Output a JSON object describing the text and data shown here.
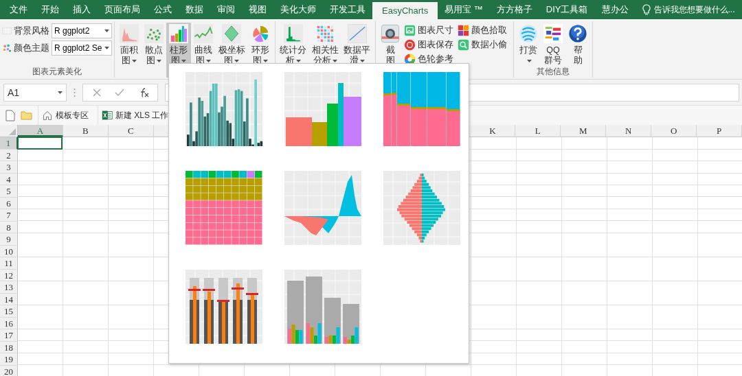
{
  "menu_tabs": [
    {
      "label": "文件",
      "selected": false
    },
    {
      "label": "开始",
      "selected": false
    },
    {
      "label": "插入",
      "selected": false
    },
    {
      "label": "页面布局",
      "selected": false
    },
    {
      "label": "公式",
      "selected": false
    },
    {
      "label": "数据",
      "selected": false
    },
    {
      "label": "审阅",
      "selected": false
    },
    {
      "label": "视图",
      "selected": false
    },
    {
      "label": "美化大师",
      "selected": false
    },
    {
      "label": "开发工具",
      "selected": false
    },
    {
      "label": "EasyCharts",
      "selected": true
    },
    {
      "label": "易用宝 ™",
      "selected": false
    },
    {
      "label": "方方格子",
      "selected": false
    },
    {
      "label": "DIY工具箱",
      "selected": false
    },
    {
      "label": "慧办公",
      "selected": false
    }
  ],
  "tell_me": {
    "placeholder": "告诉我您想要做什么..."
  },
  "ribbon": {
    "groups": [
      {
        "kind": "styles",
        "title": "图表元素美化",
        "rows": [
          {
            "label": "背景风格",
            "value": "R ggplot2"
          },
          {
            "label": "颜色主题",
            "value": "R ggplot2 Se"
          }
        ]
      },
      {
        "kind": "large",
        "buttons": [
          {
            "label": "面积图",
            "dropdown": true,
            "pressed": false
          },
          {
            "label": "散点图",
            "dropdown": true,
            "pressed": false
          },
          {
            "label": "柱形图",
            "dropdown": true,
            "pressed": true
          },
          {
            "label": "曲线图",
            "dropdown": true,
            "pressed": false
          },
          {
            "label": "极坐标图",
            "dropdown": true,
            "pressed": false
          },
          {
            "label": "环形图",
            "dropdown": true,
            "pressed": false
          }
        ]
      },
      {
        "kind": "large",
        "buttons": [
          {
            "label": "统计分析",
            "dropdown": true,
            "pressed": false
          },
          {
            "label": "相关性分析",
            "dropdown": true,
            "pressed": false
          },
          {
            "label": "数据平滑",
            "dropdown": true,
            "pressed": false
          }
        ]
      },
      {
        "kind": "tools",
        "buttons": [
          {
            "label": "截图",
            "dropdown": false,
            "pressed": false
          }
        ],
        "small": [
          {
            "label": "图表尺寸"
          },
          {
            "label": "图表保存"
          },
          {
            "label": "色轮参考"
          },
          {
            "label": "颜色拾取"
          },
          {
            "label": "数据小偷"
          }
        ]
      },
      {
        "kind": "large",
        "title": "其他信息",
        "buttons": [
          {
            "label": "打赏",
            "dropdown": true,
            "pressed": false
          },
          {
            "label": "QQ群号",
            "dropdown": false,
            "pressed": false
          },
          {
            "label": "帮助",
            "dropdown": false,
            "pressed": false
          }
        ]
      }
    ]
  },
  "formula_bar": {
    "name_box": "A1"
  },
  "quick_bar": [
    {
      "kind": "new"
    },
    {
      "kind": "folder"
    },
    {
      "kind": "link",
      "label": "模板专区"
    },
    {
      "kind": "link",
      "label": "新建 XLS 工作"
    }
  ],
  "sheet": {
    "columns_left": [
      {
        "label": "A",
        "selected": true
      },
      {
        "label": "B",
        "selected": false
      },
      {
        "label": "C",
        "selected": false
      }
    ],
    "columns_right": [
      {
        "label": "K",
        "selected": false
      },
      {
        "label": "L",
        "selected": false
      },
      {
        "label": "M",
        "selected": false
      },
      {
        "label": "N",
        "selected": false
      },
      {
        "label": "O",
        "selected": false
      },
      {
        "label": "P",
        "selected": false
      }
    ],
    "rows": [
      {
        "label": "1",
        "selected": true
      },
      {
        "label": "2",
        "selected": false
      },
      {
        "label": "3",
        "selected": false
      },
      {
        "label": "4",
        "selected": false
      },
      {
        "label": "5",
        "selected": false
      },
      {
        "label": "6",
        "selected": false
      },
      {
        "label": "7",
        "selected": false
      },
      {
        "label": "8",
        "selected": false
      },
      {
        "label": "9",
        "selected": false
      },
      {
        "label": "10",
        "selected": false
      },
      {
        "label": "11",
        "selected": false
      },
      {
        "label": "12",
        "selected": false
      },
      {
        "label": "13",
        "selected": false
      },
      {
        "label": "14",
        "selected": false
      },
      {
        "label": "15",
        "selected": false
      },
      {
        "label": "16",
        "selected": false
      },
      {
        "label": "17",
        "selected": false
      },
      {
        "label": "18",
        "selected": false
      },
      {
        "label": "19",
        "selected": false
      },
      {
        "label": "20",
        "selected": false
      }
    ]
  },
  "gallery": {
    "items": [
      {
        "kind": "columns"
      },
      {
        "kind": "histogram"
      },
      {
        "kind": "marimekko"
      },
      {
        "kind": "mosaic"
      },
      {
        "kind": "area"
      },
      {
        "kind": "pyramid"
      },
      {
        "kind": "bullet"
      },
      {
        "kind": "grouped"
      }
    ]
  }
}
